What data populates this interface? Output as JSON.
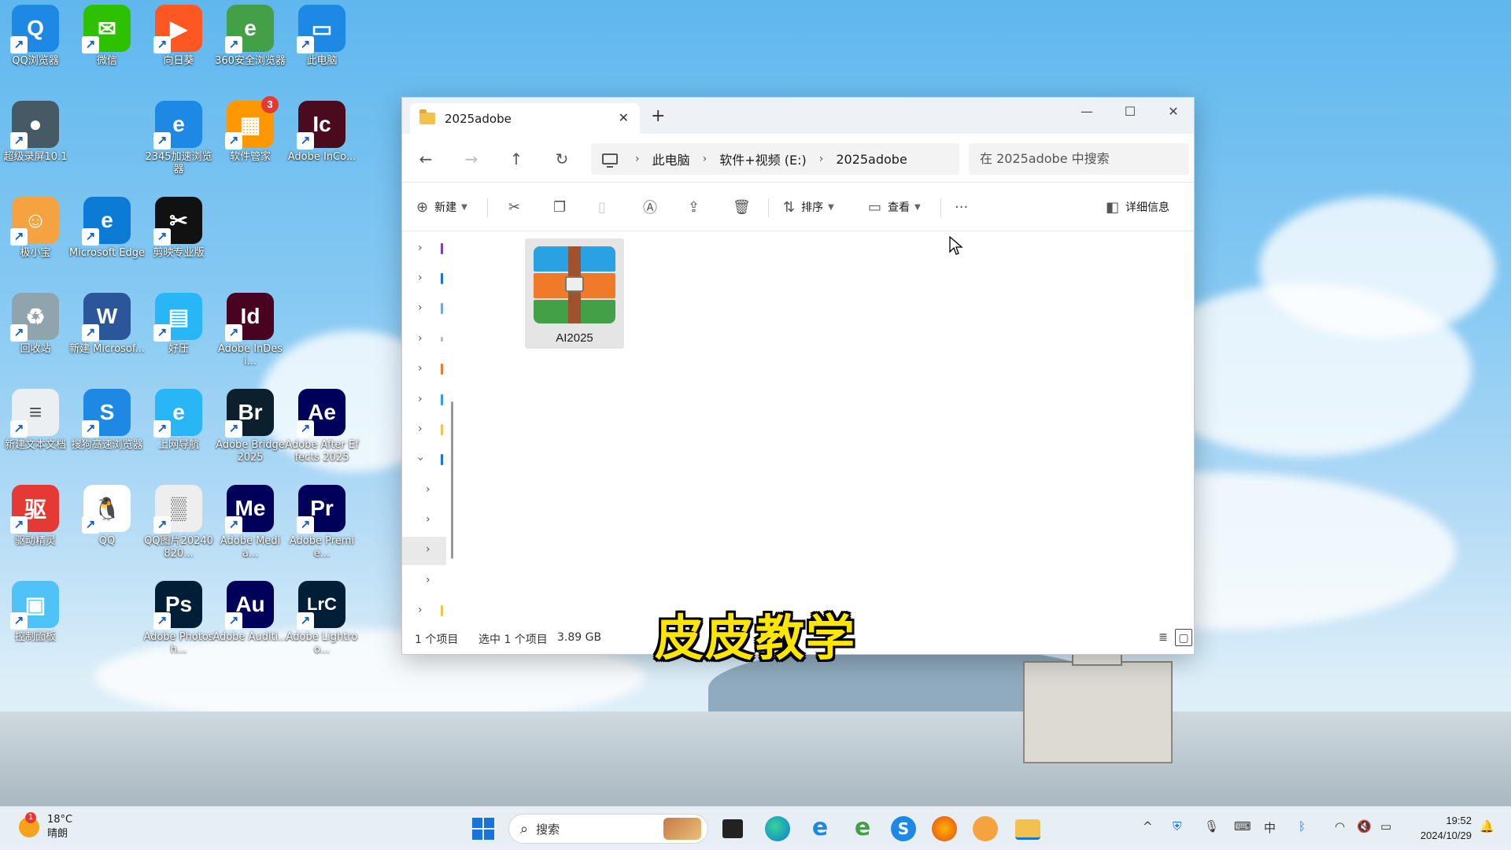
{
  "desktop": {
    "icons": [
      {
        "label": "QQ浏览器",
        "icon": "qq-browser-icon",
        "color": "#1e88e5",
        "glyph": "Q"
      },
      {
        "label": "微信",
        "icon": "wechat-icon",
        "color": "#2dc100",
        "glyph": "✉"
      },
      {
        "label": "向日葵",
        "icon": "sunflower-icon",
        "color": "#ff5722",
        "glyph": "▶"
      },
      {
        "label": "360安全浏览器",
        "icon": "360-browser-icon",
        "color": "#43a047",
        "glyph": "e"
      },
      {
        "label": "此电脑",
        "icon": "this-pc-icon",
        "color": "#1e88e5",
        "glyph": "▭"
      },
      {
        "label": "超级录屏10.1",
        "icon": "screen-recorder-icon",
        "color": "#455a64",
        "glyph": "●"
      },
      {
        "label": "2345加速浏览器",
        "icon": "2345-browser-icon",
        "color": "#1e88e5",
        "glyph": "e"
      },
      {
        "label": "软件管家",
        "icon": "software-manager-icon",
        "color": "#ff9800",
        "glyph": "▦",
        "badge": "3"
      },
      {
        "label": "Adobe InCo...",
        "icon": "adobe-incopy-icon",
        "color": "#4a0b1f",
        "glyph": "Ic"
      },
      {
        "label": "极小宝",
        "icon": "mascot-icon",
        "color": "#f4a340",
        "glyph": "☺"
      },
      {
        "label": "Microsoft Edge",
        "icon": "edge-icon",
        "color": "#0c7bd6",
        "glyph": "e"
      },
      {
        "label": "剪映专业版",
        "icon": "capcut-icon",
        "color": "#111111",
        "glyph": "✂"
      },
      {
        "label": "回收站",
        "icon": "recycle-bin-icon",
        "color": "#90a4ae",
        "glyph": "♻"
      },
      {
        "label": "新建 Microsof...",
        "icon": "word-doc-icon",
        "color": "#2b579a",
        "glyph": "W"
      },
      {
        "label": "好压",
        "icon": "haozip-icon",
        "color": "#29b6f6",
        "glyph": "▤"
      },
      {
        "label": "Adobe InDesi...",
        "icon": "adobe-indesign-icon",
        "color": "#49021f",
        "glyph": "Id"
      },
      {
        "label": "新建文本文档",
        "icon": "text-doc-icon",
        "color": "#eceff1",
        "glyph": "≡"
      },
      {
        "label": "搜狗高速浏览器",
        "icon": "sogou-browser-icon",
        "color": "#1e88e5",
        "glyph": "S"
      },
      {
        "label": "上网导航",
        "icon": "ie-nav-icon",
        "color": "#29b6f6",
        "glyph": "e"
      },
      {
        "label": "Adobe Bridge 2025",
        "icon": "adobe-bridge-icon",
        "color": "#0c1f2c",
        "glyph": "Br"
      },
      {
        "label": "Adobe After Effects 2025",
        "icon": "adobe-aftereffects-icon",
        "color": "#00005b",
        "glyph": "Ae"
      },
      {
        "label": "驱动精灵",
        "icon": "driver-genius-icon",
        "color": "#e53935",
        "glyph": "驱"
      },
      {
        "label": "QQ",
        "icon": "qq-icon",
        "color": "#ffffff",
        "glyph": "🐧"
      },
      {
        "label": "QQ图片20240820...",
        "icon": "image-file-icon",
        "color": "#eeeeee",
        "glyph": "▒"
      },
      {
        "label": "Adobe Media...",
        "icon": "adobe-media-encoder-icon",
        "color": "#00005b",
        "glyph": "Me"
      },
      {
        "label": "Adobe Premie...",
        "icon": "adobe-premiere-icon",
        "color": "#00005b",
        "glyph": "Pr"
      },
      {
        "label": "控制面板",
        "icon": "control-panel-icon",
        "color": "#4fc3f7",
        "glyph": "▣"
      },
      {
        "label": "Adobe Photosh...",
        "icon": "adobe-photoshop-icon",
        "color": "#001e36",
        "glyph": "Ps"
      },
      {
        "label": "Adobe Auditi...",
        "icon": "adobe-audition-icon",
        "color": "#00005b",
        "glyph": "Au"
      },
      {
        "label": "Adobe Lightroo...",
        "icon": "adobe-lightroom-icon",
        "color": "#001e36",
        "glyph": "LrC"
      }
    ]
  },
  "explorer": {
    "tab_title": "2025adobe",
    "breadcrumb": [
      "此电脑",
      "软件+视频 (E:)",
      "2025adobe"
    ],
    "search_placeholder": "在 2025adobe 中搜索",
    "toolbar": {
      "new": "新建",
      "sort": "排序",
      "view": "查看",
      "more": "···",
      "details": "详细信息"
    },
    "files": [
      {
        "name": "AI2025",
        "icon": "winrar-archive-icon"
      }
    ],
    "status": {
      "count": "1 个项目",
      "selected": "选中 1 个项目",
      "size": "3.89 GB"
    }
  },
  "overlay_caption": "皮皮教学",
  "taskbar": {
    "weather_temp": "18°C",
    "weather_desc": "晴朗",
    "weather_badge": "1",
    "search_label": "搜索",
    "time": "19:52",
    "date": "2024/10/29"
  }
}
